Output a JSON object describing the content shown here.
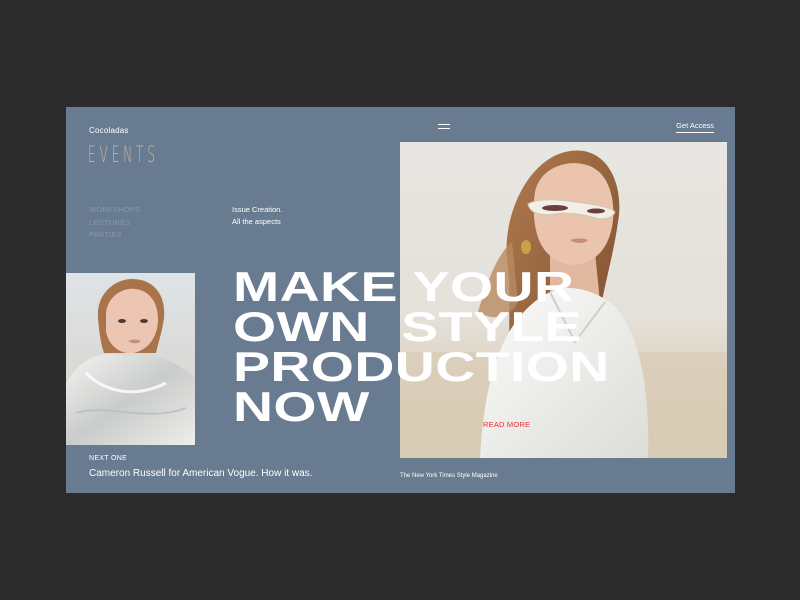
{
  "header": {
    "brand": "Cocoladas",
    "section_title": "EVENTS",
    "cta_label": "Get Access"
  },
  "nav": {
    "items": [
      {
        "label": "WORKSHOPS"
      },
      {
        "label": "LECTURES"
      },
      {
        "label": "PARTIES"
      }
    ]
  },
  "intro": {
    "line1": "Issue Creation.",
    "line2": "All the aspects"
  },
  "hero": {
    "headline_lines": [
      "MAKE YOUR",
      "OWN  STYLE",
      "PRODUCTION",
      "NOW"
    ],
    "read_more": "READ MORE",
    "caption": "The New York Times Style Magazine"
  },
  "next": {
    "label": "NEXT ONE",
    "title": "Cameron Russell for American Vogue. How it was."
  },
  "icons": {
    "menu": "menu-icon"
  },
  "colors": {
    "page_background": "#2c2c2c",
    "panel_background": "#687b90",
    "accent_beige": "#c8b7a1",
    "read_more_red": "#e5312f",
    "nav_muted": "#8799ab"
  }
}
